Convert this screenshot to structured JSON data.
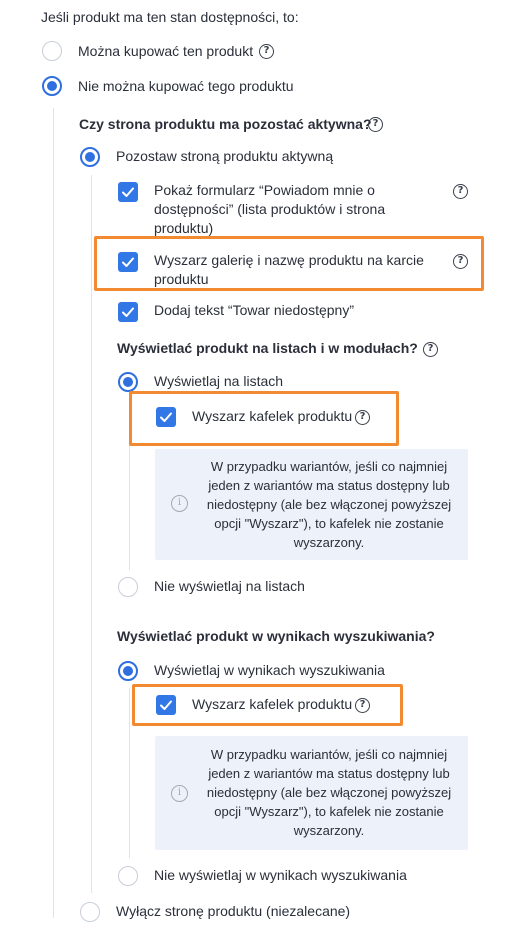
{
  "intro": "Jeśli produkt ma ten stan dostępności, to:",
  "opt_can_buy": "Można kupować ten produkt",
  "opt_cannot_buy": "Nie można kupować tego produktu",
  "q_page_active": "Czy strona produktu ma pozostać aktywna?",
  "opt_stay_active": "Pozostaw stroną produktu aktywną",
  "chk_notify": "Pokaż formularz “Powiadom mnie o dostępności” (lista produktów i strona produktu)",
  "chk_gallery": "Wyszarz galerię i nazwę produktu na karcie produktu",
  "chk_unavailable_text": "Dodaj tekst “Towar niedostępny”",
  "q_lists": "Wyświetlać produkt na listach i w modułach?",
  "opt_show_lists": "Wyświetlaj na listach",
  "chk_tile_lists": "Wyszarz kafelek produktu",
  "info_lists": "W przypadku wariantów, jeśli co najmniej jeden z wariantów ma status dostępny lub niedostępny (ale bez włączonej powyższej opcji \"Wyszarz\"), to kafelek nie zostanie wyszarzony.",
  "opt_hide_lists": "Nie wyświetlaj na listach",
  "q_search": "Wyświetlać produkt w wynikach wyszukiwania?",
  "opt_show_search": "Wyświetlaj w wynikach wyszukiwania",
  "chk_tile_search": "Wyszarz kafelek produktu",
  "info_search": "W przypadku wariantów, jeśli co najmniej jeden z wariantów ma status dostępny lub niedostępny (ale bez włączonej powyższej opcji \"Wyszarz\"), to kafelek nie zostanie wyszarzony.",
  "opt_hide_search": "Nie wyświetlaj w wynikach wyszukiwania",
  "opt_disable_page": "Wyłącz stronę produktu (niezalecane)",
  "help_glyph": "?",
  "info_glyph": "i",
  "colors": {
    "accent": "#3277e6",
    "highlight": "#f28a32",
    "info_bg": "#edf1fa"
  }
}
